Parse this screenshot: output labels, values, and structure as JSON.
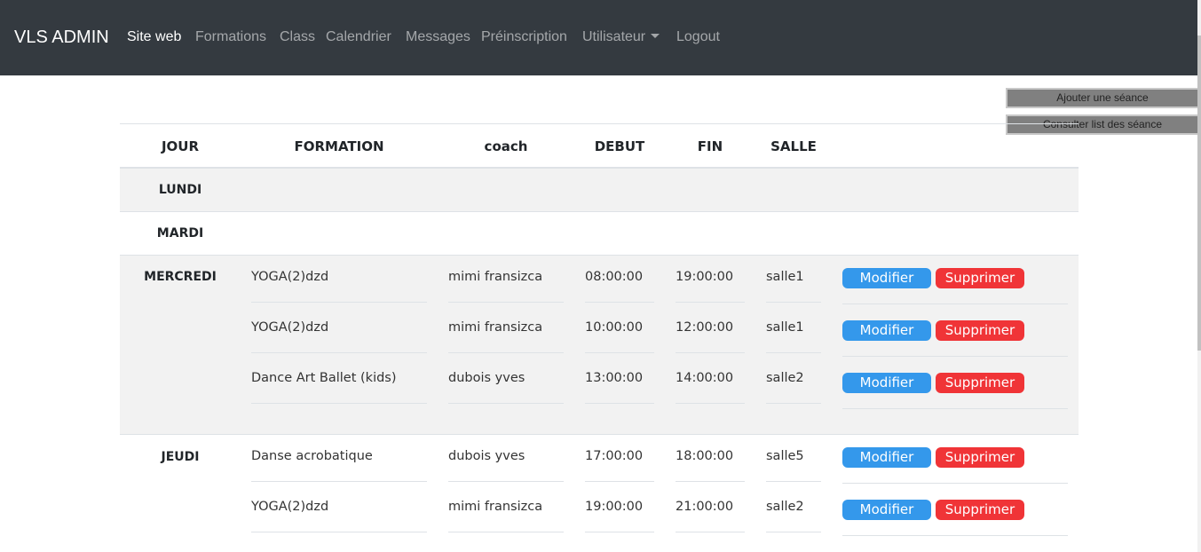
{
  "navbar": {
    "brand": "VLS ADMIN",
    "items": [
      {
        "label": "Site web",
        "active": true
      },
      {
        "label": "Formations"
      },
      {
        "label": "Class"
      },
      {
        "label": "Calendrier"
      },
      {
        "label": "Messages"
      },
      {
        "label": "Préinscription"
      },
      {
        "label": "Utilisateur"
      },
      {
        "label": "Logout"
      }
    ]
  },
  "side_buttons": {
    "add": "Ajouter une séance",
    "list": "Consulter list des séance"
  },
  "table": {
    "headers": [
      "JOUR",
      "FORMATION",
      "coach",
      "DEBUT",
      "FIN",
      "SALLE"
    ],
    "days": [
      "LUNDI",
      "MARDI",
      "MERCREDI",
      "JEUDI"
    ],
    "rows": [
      {
        "formation": "YOGA(2)dzd",
        "coach": "mimi fransizca",
        "debut": "08:00:00",
        "fin": "19:00:00",
        "salle": "salle1"
      },
      {
        "formation": "YOGA(2)dzd",
        "coach": "mimi fransizca",
        "debut": "10:00:00",
        "fin": "12:00:00",
        "salle": "salle1"
      },
      {
        "formation": "Dance Art Ballet (kids)",
        "coach": "dubois yves",
        "debut": "13:00:00",
        "fin": "14:00:00",
        "salle": "salle2"
      },
      {
        "formation": "Danse acrobatique",
        "coach": "dubois yves",
        "debut": "17:00:00",
        "fin": "18:00:00",
        "salle": "salle5"
      },
      {
        "formation": "YOGA(2)dzd",
        "coach": "mimi fransizca",
        "debut": "19:00:00",
        "fin": "21:00:00",
        "salle": "salle2"
      }
    ],
    "modify_label": "Modifier",
    "delete_label": "Supprimer"
  },
  "colors": {
    "navbar_bg": "#343a40",
    "striped_bg": "#f2f2f2",
    "modify_btn": "#3498eb",
    "delete_btn": "#f03437"
  }
}
